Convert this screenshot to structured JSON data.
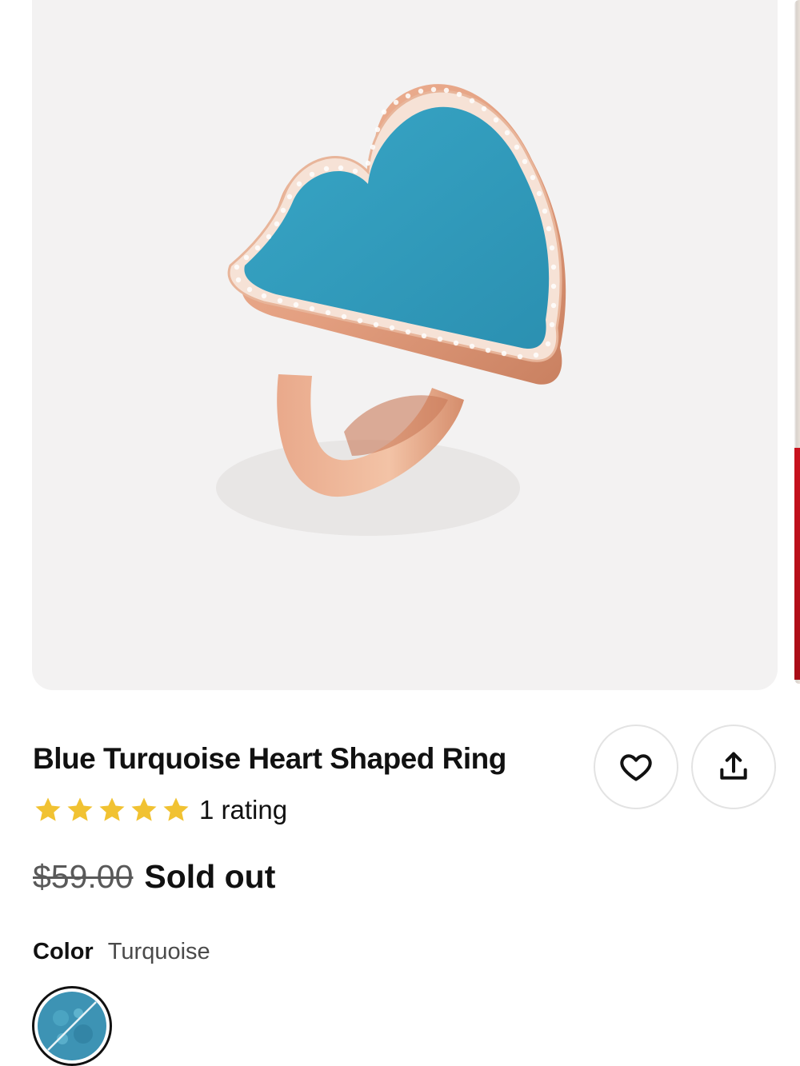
{
  "product": {
    "image_alt": "Blue turquoise heart ring in rose gold with pave stones",
    "title": "Blue Turquoise Heart Shaped Ring",
    "rating": {
      "stars": 5,
      "max_stars": 5,
      "text": "1 rating",
      "star_color": "#f1c232"
    },
    "price": {
      "original": "$59.00",
      "status": "Sold out"
    },
    "color": {
      "label": "Color",
      "value": "Turquoise",
      "swatch_color": "#3d93b4"
    }
  },
  "actions": {
    "favorite_icon": "heart-icon",
    "share_icon": "share-icon"
  },
  "theme": {
    "gallery_bg": "#f3f2f2",
    "gem_color": "#2f9cbc",
    "metal_color": "#e6a688"
  }
}
